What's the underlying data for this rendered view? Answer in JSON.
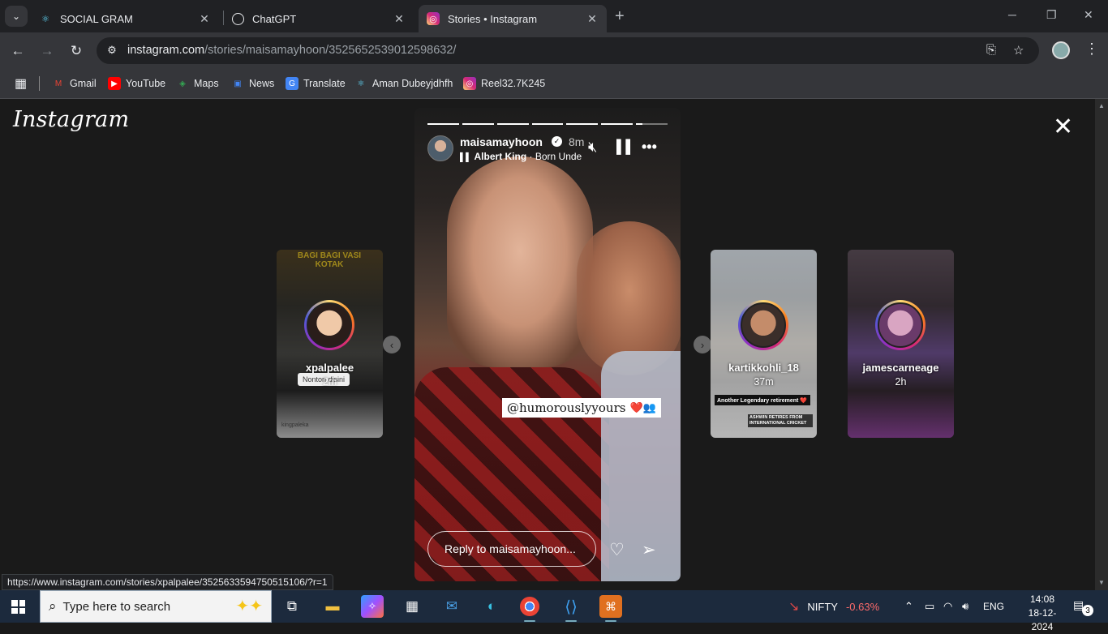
{
  "tabs": [
    {
      "label": "SOCIAL GRAM",
      "icon": "react-icon"
    },
    {
      "label": "ChatGPT",
      "icon": "chatgpt-icon"
    },
    {
      "label": "Stories • Instagram",
      "icon": "instagram-icon",
      "active": true
    }
  ],
  "address": {
    "host": "instagram.com",
    "path": "/stories/maisamayhoon/3525652539012598632/"
  },
  "bookmarks": [
    {
      "label": "Gmail",
      "icon": "gmail-icon",
      "color": "#ea4335"
    },
    {
      "label": "YouTube",
      "icon": "youtube-icon",
      "color": "#ff0000"
    },
    {
      "label": "Maps",
      "icon": "maps-icon",
      "color": "#34a853"
    },
    {
      "label": "News",
      "icon": "news-icon",
      "color": "#4285f4"
    },
    {
      "label": "Translate",
      "icon": "translate-icon",
      "color": "#4285f4"
    },
    {
      "label": "Aman Dubeyjdhfh",
      "icon": "react-icon",
      "color": "#61dafb"
    },
    {
      "label": "Reel32.7K245",
      "icon": "instagram-icon",
      "color": "#d62976"
    }
  ],
  "instagram": {
    "logo": "Instagram",
    "current_story": {
      "username": "maisamayhoon",
      "time": "8m",
      "music_artist": "Albert King",
      "music_title": "Born Unde",
      "mention": "@humorouslyyours",
      "mention_emoji": "❤️👥",
      "reply_placeholder": "Reply to maisamayhoon...",
      "segments_total": 7,
      "segments_done": 6,
      "segment_progress": 0.2
    },
    "side_stories": [
      {
        "username": "xpalpalee",
        "time": "2m",
        "overlay_text": "BAGI BAGI VASI KOTAK",
        "tag": "Nonton disini",
        "footer": "kingpaleka"
      },
      {
        "username": "kartikkohli_18",
        "time": "37m",
        "overlay_text": "Another Legendary retirement ❤️",
        "footer": "ASHWIN RETIRES FROM INTERNATIONAL CRICKET"
      },
      {
        "username": "jamescarneage",
        "time": "2h"
      }
    ]
  },
  "statusbar_url": "https://www.instagram.com/stories/xpalpalee/3525633594750515106/?r=1",
  "taskbar": {
    "search_placeholder": "Type here to search",
    "nifty_label": "NIFTY",
    "nifty_change": "-0.63%",
    "language": "ENG",
    "time": "14:08",
    "date": "18-12-2024",
    "notifications": "3"
  }
}
